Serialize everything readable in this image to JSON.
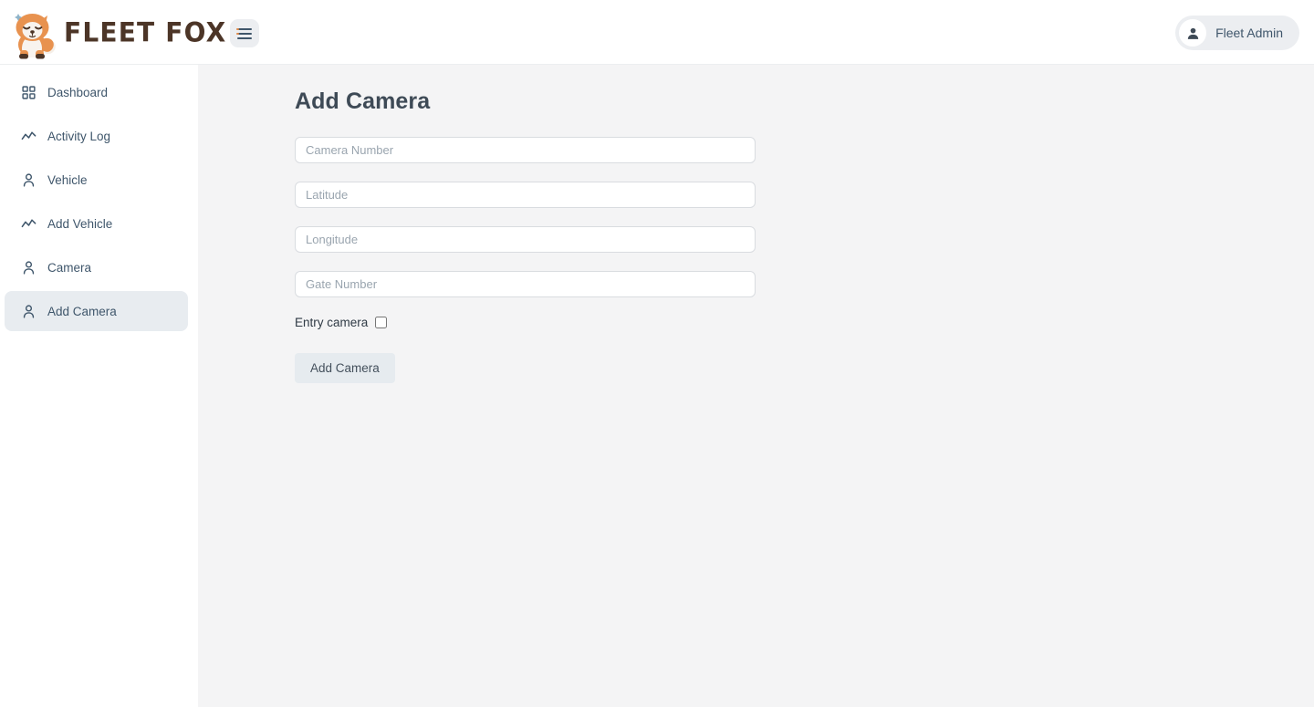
{
  "brand": {
    "name": "FLEET FOX",
    "logo_icon": "fox-logo-icon",
    "logo_colors": {
      "body": "#e8924f",
      "body_dark": "#d97b38",
      "fur_light": "#f8f3ee",
      "paw": "#4c3527",
      "text": "#4c3527"
    }
  },
  "header": {
    "menu_icon": "hamburger-menu-icon",
    "user": {
      "name": "Fleet Admin",
      "avatar_icon": "user-avatar-icon"
    }
  },
  "sidebar": {
    "items": [
      {
        "label": "Dashboard",
        "icon": "grid-icon",
        "active": false
      },
      {
        "label": "Activity Log",
        "icon": "trend-icon",
        "active": false
      },
      {
        "label": "Vehicle",
        "icon": "person-icon",
        "active": false
      },
      {
        "label": "Add Vehicle",
        "icon": "trend-icon",
        "active": false
      },
      {
        "label": "Camera",
        "icon": "person-icon",
        "active": false
      },
      {
        "label": "Add Camera",
        "icon": "person-icon",
        "active": true
      }
    ]
  },
  "main": {
    "title": "Add Camera",
    "fields": [
      {
        "name": "camera-number",
        "placeholder": "Camera Number",
        "value": ""
      },
      {
        "name": "latitude",
        "placeholder": "Latitude",
        "value": ""
      },
      {
        "name": "longitude",
        "placeholder": "Longitude",
        "value": ""
      },
      {
        "name": "gate-number",
        "placeholder": "Gate Number",
        "value": ""
      }
    ],
    "checkbox": {
      "label": "Entry camera",
      "checked": false
    },
    "submit_label": "Add Camera"
  },
  "colors": {
    "accent_orange": "#e8924f",
    "brand_brown": "#4c3527",
    "slate": "#3f566b",
    "content_bg": "#f4f4f5",
    "active_item_bg": "#e8ecf0",
    "button_bg": "#e6ebef"
  }
}
